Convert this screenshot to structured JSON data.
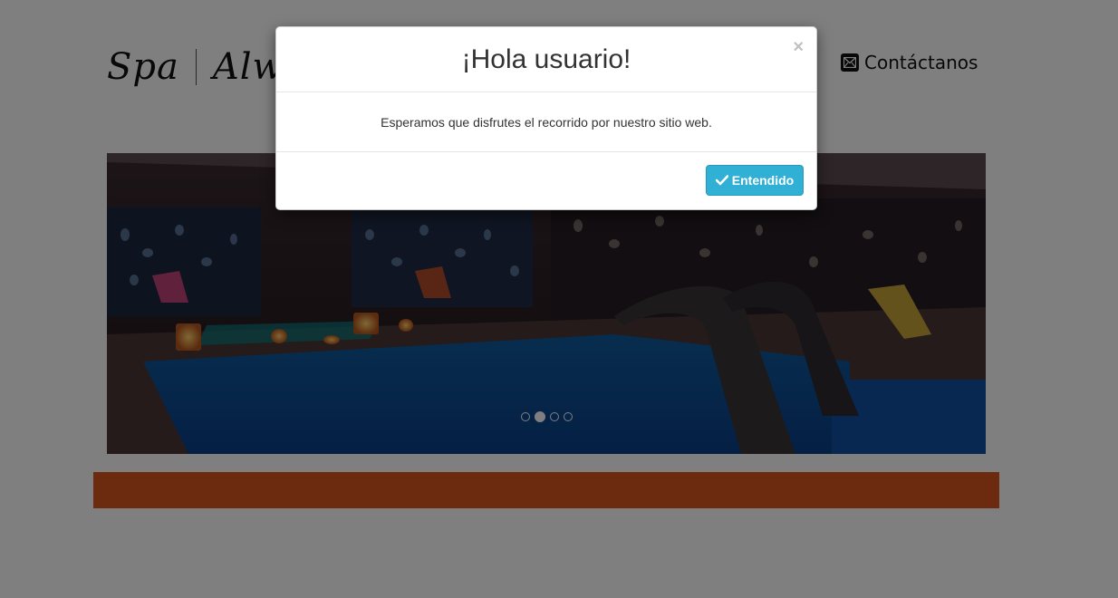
{
  "header": {
    "logo_left": "Spa",
    "logo_right": "Always",
    "contact_label": "Contáctanos",
    "contact_icon": "envelope-icon"
  },
  "carousel": {
    "slide_count": 4,
    "active_index": 1
  },
  "modal": {
    "title": "¡Hola usuario!",
    "close_label": "×",
    "message": "Esperamos que disfrutes el recorrido por nuestro sitio web.",
    "button_label": "Entendido",
    "button_icon": "check-icon"
  },
  "colors": {
    "accent_bar": "#d9541e",
    "button": "#31b0d5",
    "backdrop_opacity": 0.5
  }
}
